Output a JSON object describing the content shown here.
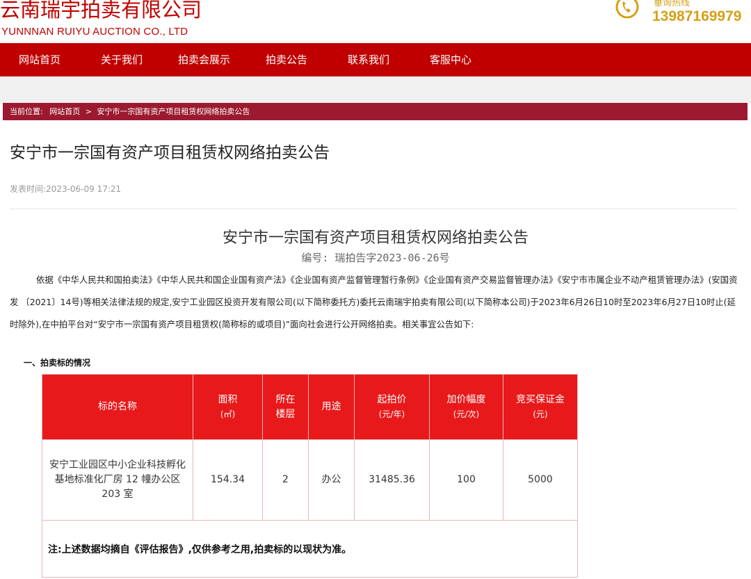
{
  "header": {
    "company_cn": "云南瑞宇拍卖有限公司",
    "company_en": "YUNNNAN RUIYU AUCTION CO., LTD",
    "hotline_label": "垂询热线",
    "hotline_number": "13987169979"
  },
  "nav": {
    "items": [
      {
        "label": "网站首页"
      },
      {
        "label": "关于我们"
      },
      {
        "label": "拍卖会展示"
      },
      {
        "label": "拍卖公告"
      },
      {
        "label": "联系我们"
      },
      {
        "label": "客服中心"
      }
    ]
  },
  "breadcrumb": {
    "prefix": "当前位置:",
    "home": "网站首页",
    "separator": ">",
    "current": "安宁市一宗国有资产项目租赁权网络拍卖公告"
  },
  "page": {
    "title": "安宁市一宗国有资产项目租赁权网络拍卖公告",
    "publish_label": "发表时间:",
    "publish_time": "2023-06-09 17:21"
  },
  "article": {
    "title": "安宁市一宗国有资产项目租赁权网络拍卖公告",
    "number": "编号: 瑞拍告字2023-06-26号",
    "paragraph": "依据《中华人民共和国拍卖法》《中华人民共和国企业国有资产法》《企业国有资产监督管理暂行条例》《企业国有资产交易监督管理办法》《安宁市市属企业不动产租赁管理办法》(安国资发 〔2021〕14号)等相关法律法规的规定,安宁工业园区投资开发有限公司(以下简称委托方)委托云南瑞宇拍卖有限公司(以下简称本公司)于2023年6月26日10时至2023年6月27日10时止(延时除外),在中拍平台对“安宁市一宗国有资产项目租赁权(简称标的或项目)”面向社会进行公开网络拍卖。相关事宜公告如下:",
    "section1_heading": "一、拍卖标的情况"
  },
  "table": {
    "headers": [
      {
        "label": "标的名称",
        "unit": ""
      },
      {
        "label": "面积",
        "unit": "(㎡)"
      },
      {
        "label": "所在楼层",
        "unit": ""
      },
      {
        "label": "用途",
        "unit": ""
      },
      {
        "label": "起拍价",
        "unit": "(元/年)"
      },
      {
        "label": "加价幅度",
        "unit": "(元/次)"
      },
      {
        "label": "竞买保证金",
        "unit": "(元)"
      }
    ],
    "rows": [
      {
        "name": "安宁工业园区中小企业科技孵化基地标准化厂房 12 幢办公区 203 室",
        "area": "154.34",
        "floor": "2",
        "usage": "办公",
        "start_price": "31485.36",
        "increment": "100",
        "deposit": "5000"
      }
    ],
    "note": "注:上述数据均摘自《评估报告》,仅供参考之用,拍卖标的以现状为准。"
  },
  "colors": {
    "brand_red": "#c00000",
    "breadcrumb_bg": "#9b1a2f",
    "table_header_bg": "#e8191a",
    "hotline_gold": "#d4a017"
  }
}
